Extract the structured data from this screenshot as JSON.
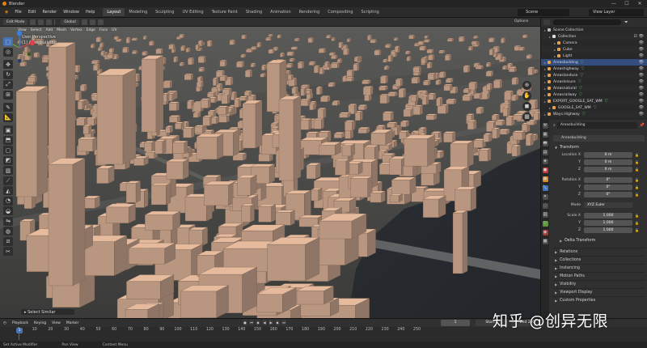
{
  "window": {
    "title": "Blender",
    "controls": [
      "—",
      "☐",
      "✕"
    ]
  },
  "menu": [
    "File",
    "Edit",
    "Render",
    "Window",
    "Help"
  ],
  "workspaces": [
    "Layout",
    "Modeling",
    "Sculpting",
    "UV Editing",
    "Texture Paint",
    "Shading",
    "Animation",
    "Rendering",
    "Compositing",
    "Scripting"
  ],
  "active_workspace": "Layout",
  "scene": "Scene",
  "view_layer": "View Layer",
  "tool_header": {
    "mode": "Edit Mode",
    "orientation": "Global",
    "options": "Options"
  },
  "viewport_header": [
    "View",
    "Select",
    "Add",
    "Mesh",
    "Vertex",
    "Edge",
    "Face",
    "UV"
  ],
  "viewport_overlay": {
    "line1": "User Perspective",
    "line2": "(1) Areasbuilding"
  },
  "last_operator": "Select Similar",
  "outliner": {
    "title": "Scene Collection",
    "rows": [
      {
        "name": "Scene Collection",
        "indent": 0,
        "icon": "#bbbbbb",
        "selected": false,
        "eye": false
      },
      {
        "name": "Collection",
        "indent": 1,
        "icon": "#dddddd",
        "selected": false,
        "eye": true
      },
      {
        "name": "Camera",
        "indent": 2,
        "icon": "#e8a04a",
        "selected": false,
        "eye": true
      },
      {
        "name": "Cube",
        "indent": 2,
        "icon": "#e8a04a",
        "selected": false,
        "eye": true
      },
      {
        "name": "Light",
        "indent": 2,
        "icon": "#e8a04a",
        "selected": false,
        "eye": true
      },
      {
        "name": "Areasbuilding",
        "indent": 0,
        "icon": "#e8a04a",
        "selected": true,
        "eye": true
      },
      {
        "name": "Areashighway",
        "indent": 0,
        "icon": "#e8a04a",
        "selected": false,
        "eye": true
      },
      {
        "name": "Areaslanduse",
        "indent": 0,
        "icon": "#e8a04a",
        "selected": false,
        "eye": true
      },
      {
        "name": "Areasleisure",
        "indent": 0,
        "icon": "#e8a04a",
        "selected": false,
        "eye": true
      },
      {
        "name": "Areasnatural",
        "indent": 0,
        "icon": "#e8a04a",
        "selected": false,
        "eye": true
      },
      {
        "name": "Areasrailway",
        "indent": 0,
        "icon": "#e8a04a",
        "selected": false,
        "eye": true
      },
      {
        "name": "EXPORT_GOOGLE_SAT_WM",
        "indent": 0,
        "icon": "#e8a04a",
        "selected": false,
        "eye": true
      },
      {
        "name": "GOOGLE_SAT_WM",
        "indent": 1,
        "icon": "#e8a04a",
        "selected": false,
        "eye": true
      },
      {
        "name": "Ways.Highway",
        "indent": 0,
        "icon": "#e8a04a",
        "selected": false,
        "eye": true
      }
    ]
  },
  "properties": {
    "object_header": "Areasbuilding",
    "object_name": "Areasbuilding",
    "transform_label": "Transform",
    "location": {
      "label": "Location X",
      "x": "0 m",
      "y": "0 m",
      "z": "0 m"
    },
    "rotation": {
      "label": "Rotation X",
      "x": "0°",
      "y": "0°",
      "z": "0°"
    },
    "mode": {
      "label": "Mode",
      "value": "XYZ Euler"
    },
    "scale": {
      "label": "Scale X",
      "x": "1.000",
      "y": "1.000",
      "z": "1.000"
    },
    "axis_labels": {
      "y": "Y",
      "z": "Z"
    },
    "delta": "Delta Transform",
    "collapsed": [
      "Relations",
      "Collections",
      "Instancing",
      "Motion Paths",
      "Visibility",
      "Viewport Display",
      "Custom Properties"
    ]
  },
  "timeline": {
    "menus": [
      "Playback",
      "Keying",
      "View",
      "Marker"
    ],
    "current_frame": "1",
    "start_label": "Start",
    "start": "1",
    "end_label": "End",
    "end": "250",
    "ticks": [
      "1",
      "10",
      "20",
      "30",
      "40",
      "50",
      "60",
      "70",
      "80",
      "90",
      "100",
      "110",
      "120",
      "130",
      "140",
      "150",
      "160",
      "170",
      "180",
      "190",
      "200",
      "210",
      "220",
      "230",
      "240",
      "250"
    ]
  },
  "statusbar": [
    "Set Active Modifier",
    "Pan View",
    "Context Menu"
  ],
  "watermark": "知乎 @创异无限",
  "colors": {
    "accent": "#4772b3",
    "building": "#e3b597",
    "water": "#2c3036",
    "ground": "#3b3b3b"
  }
}
